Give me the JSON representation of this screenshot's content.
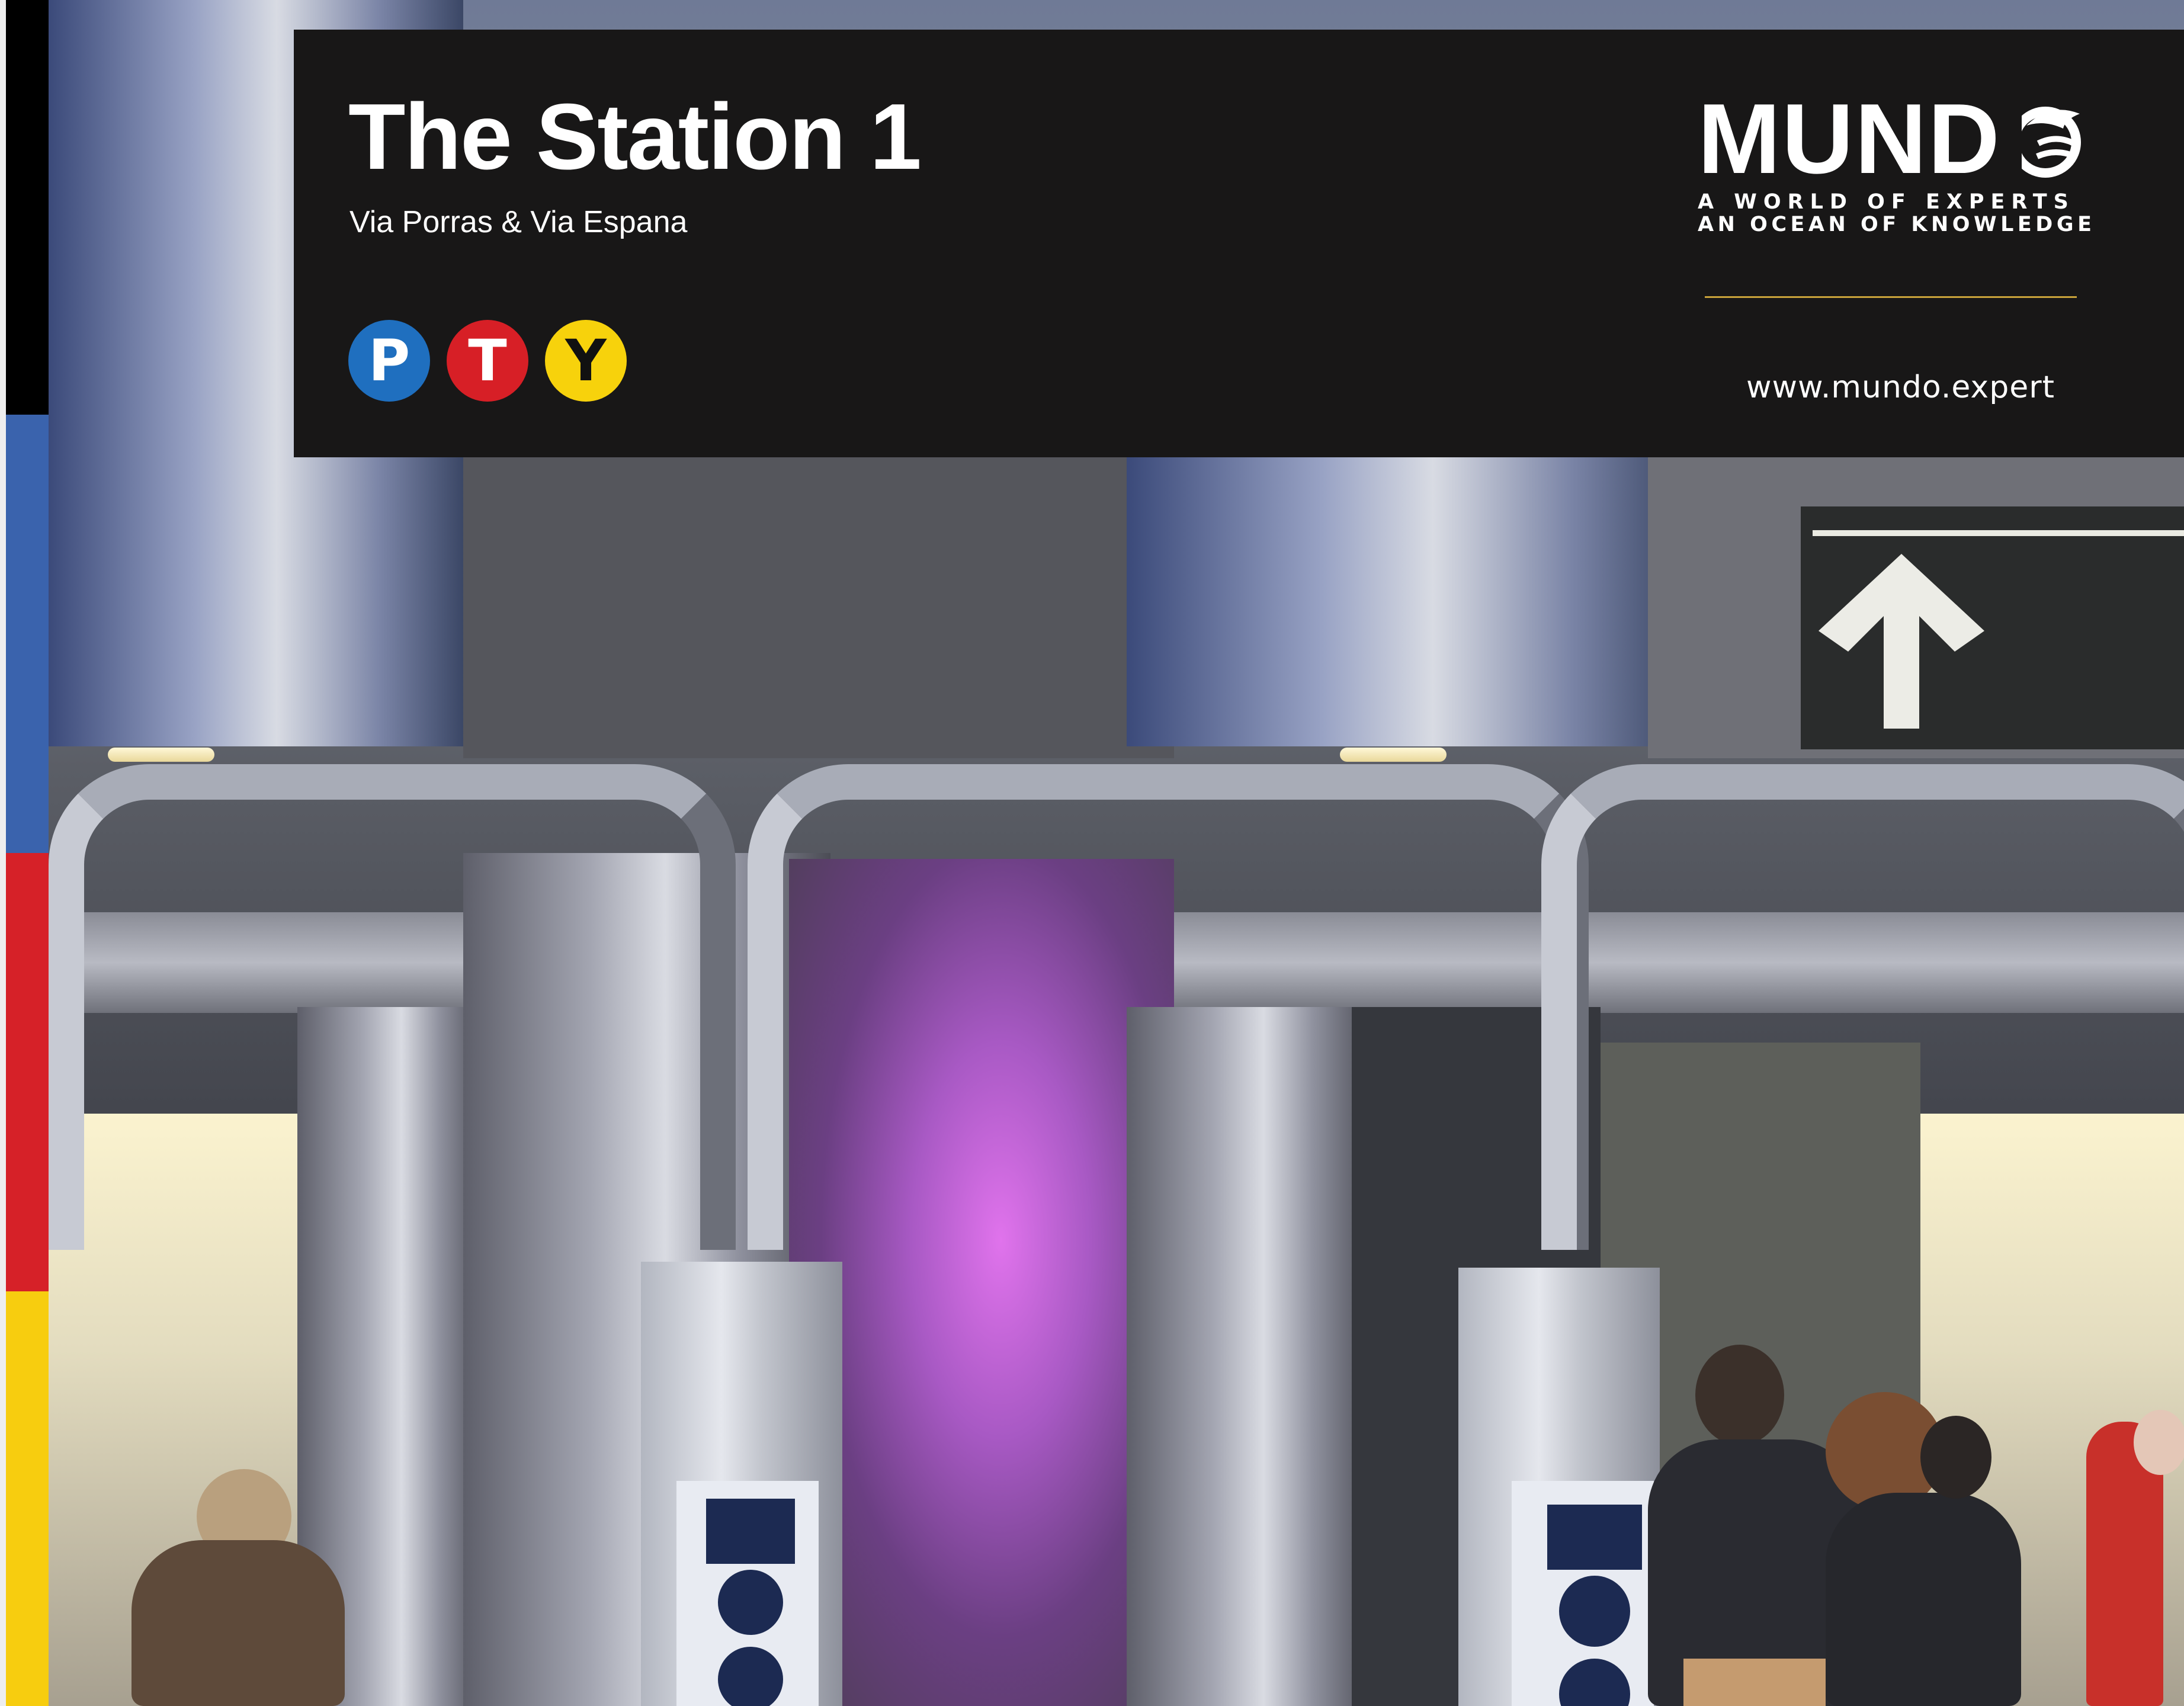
{
  "header": {
    "title": "The Station 1",
    "subtitle": "Via Porras & Via Espana",
    "line_badges": [
      {
        "letter": "P",
        "color": "#1f6fbf",
        "text_color": "#ffffff"
      },
      {
        "letter": "T",
        "color": "#d71f26",
        "text_color": "#ffffff"
      },
      {
        "letter": "Y",
        "color": "#f7d20c",
        "text_color": "#111111"
      }
    ]
  },
  "logo": {
    "wordmark": "MUND",
    "wordmark_full": "MUNDO",
    "tagline_1": "A WORLD OF EXPERTS",
    "tagline_2": "AN OCEAN OF KNOWLEDGE",
    "website": "www.mundo.expert",
    "accent_color": "#c9a23a"
  },
  "side_strip": {
    "colors": [
      "#000000",
      "#3a63ad",
      "#d62128",
      "#f7cd0f"
    ]
  },
  "photo": {
    "sign_icon": "arrow-up-icon"
  }
}
